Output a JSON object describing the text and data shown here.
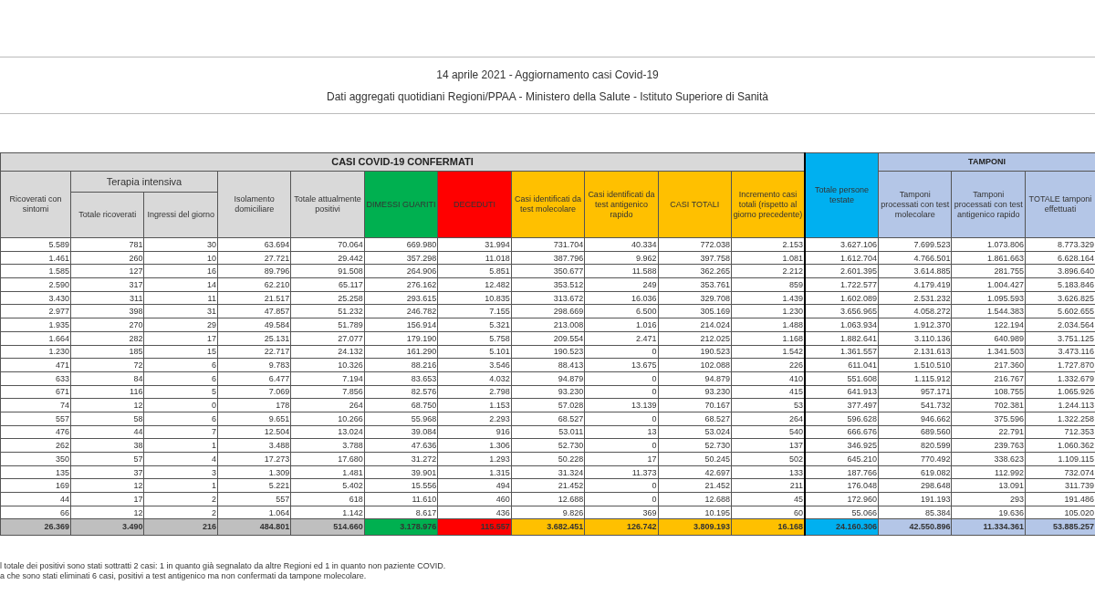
{
  "title": "14 aprile 2021 - Aggiornamento casi Covid-19",
  "subtitle": "Dati aggregati quotidiani Regioni/PPAA - Ministero della Salute - Istituto Superiore di Sanità",
  "table": {
    "groups": {
      "main": "CASI COVID-19 CONFERMATI",
      "sub": "Terapia intensiva",
      "tests": "TAMPONI"
    },
    "columns": [
      {
        "label": "Ricoverati con sintomi",
        "kind": "main",
        "color": "#d9d9d9"
      },
      {
        "label": "Totale ricoverati",
        "kind": "sub",
        "color": "#d9d9d9"
      },
      {
        "label": "Ingressi del giorno",
        "kind": "sub",
        "color": "#d9d9d9"
      },
      {
        "label": "Isolamento domiciliare",
        "kind": "main",
        "color": "#d9d9d9"
      },
      {
        "label": "Totale attualmente positivi",
        "kind": "main",
        "color": "#d9d9d9"
      },
      {
        "label": "DIMESSI GUARITI",
        "kind": "main",
        "color": "#00b050"
      },
      {
        "label": "DECEDUTI",
        "kind": "main",
        "color": "#ff0000"
      },
      {
        "label": "Casi identificati da test molecolare",
        "kind": "main",
        "color": "#ffc000"
      },
      {
        "label": "Casi identificati da test antigenico rapido",
        "kind": "main",
        "color": "#ffc000"
      },
      {
        "label": "CASI TOTALI",
        "kind": "main",
        "color": "#ffc000"
      },
      {
        "label": "Incremento casi totali (rispetto al giorno precedente)",
        "kind": "main",
        "color": "#ffc000"
      },
      {
        "label": "Totale persone testate",
        "kind": "standalone",
        "color": "#00b0f0"
      },
      {
        "label": "Tamponi processati con test molecolare",
        "kind": "tests",
        "color": "#b4c6e7"
      },
      {
        "label": "Tamponi processati con test antigenico rapido",
        "kind": "tests",
        "color": "#b4c6e7"
      },
      {
        "label": "TOTALE tamponi effettuati",
        "kind": "tests",
        "color": "#b4c6e7"
      }
    ],
    "rows": [
      [
        "5.589",
        "781",
        "30",
        "63.694",
        "70.064",
        "669.980",
        "31.994",
        "731.704",
        "40.334",
        "772.038",
        "2.153",
        "3.627.106",
        "7.699.523",
        "1.073.806",
        "8.773.329"
      ],
      [
        "1.461",
        "260",
        "10",
        "27.721",
        "29.442",
        "357.298",
        "11.018",
        "387.796",
        "9.962",
        "397.758",
        "1.081",
        "1.612.704",
        "4.766.501",
        "1.861.663",
        "6.628.164"
      ],
      [
        "1.585",
        "127",
        "16",
        "89.796",
        "91.508",
        "264.906",
        "5.851",
        "350.677",
        "11.588",
        "362.265",
        "2.212",
        "2.601.395",
        "3.614.885",
        "281.755",
        "3.896.640"
      ],
      [
        "2.590",
        "317",
        "14",
        "62.210",
        "65.117",
        "276.162",
        "12.482",
        "353.512",
        "249",
        "353.761",
        "859",
        "1.722.577",
        "4.179.419",
        "1.004.427",
        "5.183.846"
      ],
      [
        "3.430",
        "311",
        "11",
        "21.517",
        "25.258",
        "293.615",
        "10.835",
        "313.672",
        "16.036",
        "329.708",
        "1.439",
        "1.602.089",
        "2.531.232",
        "1.095.593",
        "3.626.825"
      ],
      [
        "2.977",
        "398",
        "31",
        "47.857",
        "51.232",
        "246.782",
        "7.155",
        "298.669",
        "6.500",
        "305.169",
        "1.230",
        "3.656.965",
        "4.058.272",
        "1.544.383",
        "5.602.655"
      ],
      [
        "1.935",
        "270",
        "29",
        "49.584",
        "51.789",
        "156.914",
        "5.321",
        "213.008",
        "1.016",
        "214.024",
        "1.488",
        "1.063.934",
        "1.912.370",
        "122.194",
        "2.034.564"
      ],
      [
        "1.664",
        "282",
        "17",
        "25.131",
        "27.077",
        "179.190",
        "5.758",
        "209.554",
        "2.471",
        "212.025",
        "1.168",
        "1.882.641",
        "3.110.136",
        "640.989",
        "3.751.125"
      ],
      [
        "1.230",
        "185",
        "15",
        "22.717",
        "24.132",
        "161.290",
        "5.101",
        "190.523",
        "0",
        "190.523",
        "1.542",
        "1.361.557",
        "2.131.613",
        "1.341.503",
        "3.473.116"
      ],
      [
        "471",
        "72",
        "6",
        "9.783",
        "10.326",
        "88.216",
        "3.546",
        "88.413",
        "13.675",
        "102.088",
        "226",
        "611.041",
        "1.510.510",
        "217.360",
        "1.727.870"
      ],
      [
        "633",
        "84",
        "6",
        "6.477",
        "7.194",
        "83.653",
        "4.032",
        "94.879",
        "0",
        "94.879",
        "410",
        "551.608",
        "1.115.912",
        "216.767",
        "1.332.679"
      ],
      [
        "671",
        "116",
        "5",
        "7.069",
        "7.856",
        "82.576",
        "2.798",
        "93.230",
        "0",
        "93.230",
        "415",
        "641.913",
        "957.171",
        "108.755",
        "1.065.926"
      ],
      [
        "74",
        "12",
        "0",
        "178",
        "264",
        "68.750",
        "1.153",
        "57.028",
        "13.139",
        "70.167",
        "53",
        "377.497",
        "541.732",
        "702.381",
        "1.244.113"
      ],
      [
        "557",
        "58",
        "6",
        "9.651",
        "10.266",
        "55.968",
        "2.293",
        "68.527",
        "0",
        "68.527",
        "264",
        "596.628",
        "946.662",
        "375.596",
        "1.322.258"
      ],
      [
        "476",
        "44",
        "7",
        "12.504",
        "13.024",
        "39.084",
        "916",
        "53.011",
        "13",
        "53.024",
        "540",
        "666.676",
        "689.560",
        "22.791",
        "712.353"
      ],
      [
        "262",
        "38",
        "1",
        "3.488",
        "3.788",
        "47.636",
        "1.306",
        "52.730",
        "0",
        "52.730",
        "137",
        "346.925",
        "820.599",
        "239.763",
        "1.060.362"
      ],
      [
        "350",
        "57",
        "4",
        "17.273",
        "17.680",
        "31.272",
        "1.293",
        "50.228",
        "17",
        "50.245",
        "502",
        "645.210",
        "770.492",
        "338.623",
        "1.109.115"
      ],
      [
        "135",
        "37",
        "3",
        "1.309",
        "1.481",
        "39.901",
        "1.315",
        "31.324",
        "11.373",
        "42.697",
        "133",
        "187.766",
        "619.082",
        "112.992",
        "732.074"
      ],
      [
        "169",
        "12",
        "1",
        "5.221",
        "5.402",
        "15.556",
        "494",
        "21.452",
        "0",
        "21.452",
        "211",
        "176.048",
        "298.648",
        "13.091",
        "311.739"
      ],
      [
        "44",
        "17",
        "2",
        "557",
        "618",
        "11.610",
        "460",
        "12.688",
        "0",
        "12.688",
        "45",
        "172.960",
        "191.193",
        "293",
        "191.486"
      ],
      [
        "66",
        "12",
        "2",
        "1.064",
        "1.142",
        "8.617",
        "436",
        "9.826",
        "369",
        "10.195",
        "60",
        "55.066",
        "85.384",
        "19.636",
        "105.020"
      ]
    ],
    "totals": [
      {
        "value": "26.369",
        "color": "#bfbfbf"
      },
      {
        "value": "3.490",
        "color": "#bfbfbf"
      },
      {
        "value": "216",
        "color": "#bfbfbf"
      },
      {
        "value": "484.801",
        "color": "#bfbfbf"
      },
      {
        "value": "514.660",
        "color": "#bfbfbf"
      },
      {
        "value": "3.178.976",
        "color": "#00b050"
      },
      {
        "value": "115.557",
        "color": "#ff0000"
      },
      {
        "value": "3.682.451",
        "color": "#ffc000"
      },
      {
        "value": "126.742",
        "color": "#ffc000"
      },
      {
        "value": "3.809.193",
        "color": "#ffc000"
      },
      {
        "value": "16.168",
        "color": "#ffc000"
      },
      {
        "value": "24.160.306",
        "color": "#00b0f0"
      },
      {
        "value": "42.550.896",
        "color": "#b4c6e7"
      },
      {
        "value": "11.334.361",
        "color": "#b4c6e7"
      },
      {
        "value": "53.885.257",
        "color": "#b4c6e7"
      }
    ]
  },
  "footnotes": [
    "l totale dei positivi sono stati sottratti 2 casi: 1 in quanto già segnalato da altre Regioni ed 1 in quanto non paziente COVID.",
    "a che sono stati eliminati 6 casi, positivi a test antigenico ma non confermati da tampone molecolare."
  ]
}
